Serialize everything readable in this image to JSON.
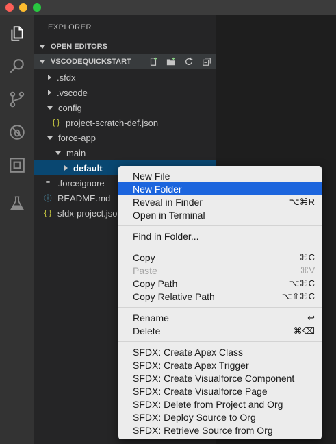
{
  "window": {
    "controls": [
      "close",
      "minimize",
      "maximize"
    ]
  },
  "activity_bar": [
    {
      "name": "explorer-icon"
    },
    {
      "name": "search-icon"
    },
    {
      "name": "source-control-icon"
    },
    {
      "name": "debug-icon"
    },
    {
      "name": "extensions-icon"
    },
    {
      "name": "flask-icon"
    }
  ],
  "sidebar": {
    "title": "EXPLORER",
    "open_editors": "OPEN EDITORS",
    "project": "VSCODEQUICKSTART",
    "actions": [
      "new-file-icon",
      "new-folder-icon",
      "refresh-icon",
      "collapse-all-icon"
    ],
    "tree": [
      {
        "label": ".sfdx",
        "state": "collapsed"
      },
      {
        "label": ".vscode",
        "state": "collapsed"
      },
      {
        "label": "config",
        "state": "expanded"
      },
      {
        "label": "project-scratch-def.json",
        "icon": "{ }"
      },
      {
        "label": "force-app",
        "state": "expanded"
      },
      {
        "label": "main",
        "state": "expanded"
      },
      {
        "label": "default",
        "state": "collapsed",
        "selected": true
      },
      {
        "label": ".forceignore",
        "icon": "≡"
      },
      {
        "label": "README.md",
        "icon": "ⓘ"
      },
      {
        "label": "sfdx-project.json",
        "icon": "{ }"
      }
    ]
  },
  "context_menu": {
    "items": [
      {
        "label": "New File",
        "shortcut": ""
      },
      {
        "label": "New Folder",
        "shortcut": "",
        "highlighted": true
      },
      {
        "label": "Reveal in Finder",
        "shortcut": "⌥⌘R"
      },
      {
        "label": "Open in Terminal",
        "shortcut": ""
      },
      {
        "label": "Find in Folder...",
        "shortcut": ""
      },
      {
        "label": "Copy",
        "shortcut": "⌘C"
      },
      {
        "label": "Paste",
        "shortcut": "⌘V",
        "disabled": true
      },
      {
        "label": "Copy Path",
        "shortcut": "⌥⌘C"
      },
      {
        "label": "Copy Relative Path",
        "shortcut": "⌥⇧⌘C"
      },
      {
        "label": "Rename",
        "shortcut": "↩"
      },
      {
        "label": "Delete",
        "shortcut": "⌘⌫"
      },
      {
        "label": "SFDX: Create Apex Class",
        "shortcut": ""
      },
      {
        "label": "SFDX: Create Apex Trigger",
        "shortcut": ""
      },
      {
        "label": "SFDX: Create Visualforce Component",
        "shortcut": ""
      },
      {
        "label": "SFDX: Create Visualforce Page",
        "shortcut": ""
      },
      {
        "label": "SFDX: Delete from Project and Org",
        "shortcut": ""
      },
      {
        "label": "SFDX: Deploy Source to Org",
        "shortcut": ""
      },
      {
        "label": "SFDX: Retrieve Source from Org",
        "shortcut": ""
      }
    ]
  },
  "colors": {
    "activity_bar": "#333333",
    "sidebar": "#252526",
    "selection": "#094771",
    "menu_highlight": "#1c65dd"
  }
}
